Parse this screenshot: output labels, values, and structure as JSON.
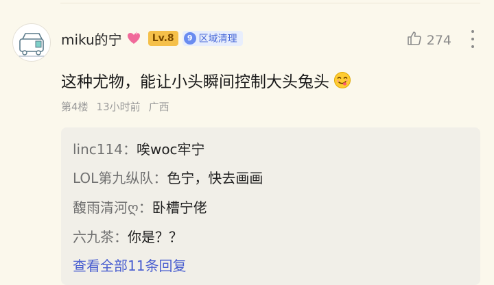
{
  "comment": {
    "username": "miku的宁",
    "level": "Lv.8",
    "region_badge": {
      "number": "9",
      "text": "区域清理"
    },
    "likes": "274",
    "text": "这种尤物，能让小头瞬间控制大头兔头",
    "floor": "第4楼",
    "time": "13小时前",
    "location": "广西",
    "icons": {
      "like": "thumbs-up-icon",
      "more": "more-vertical-icon",
      "heart": "heart-icon",
      "emoji": "savoring-face-emoji"
    }
  },
  "replies": [
    {
      "author": "linc114",
      "sep": "：",
      "text": "唉woc牢宁"
    },
    {
      "author": "LOL第九纵队",
      "sep": "：",
      "text": "色宁，快去画画"
    },
    {
      "author": "馥雨清河ღ",
      "sep": "：",
      "text": "卧槽宁佬"
    },
    {
      "author": "六九茶",
      "sep": "：",
      "text": "你是？？"
    }
  ],
  "view_all_replies": "查看全部11条回复",
  "colors": {
    "background": "#fbf8ec",
    "level_badge": "#f5c04a",
    "link": "#4a5fd0",
    "region_badge_text": "#4a6ad8"
  }
}
